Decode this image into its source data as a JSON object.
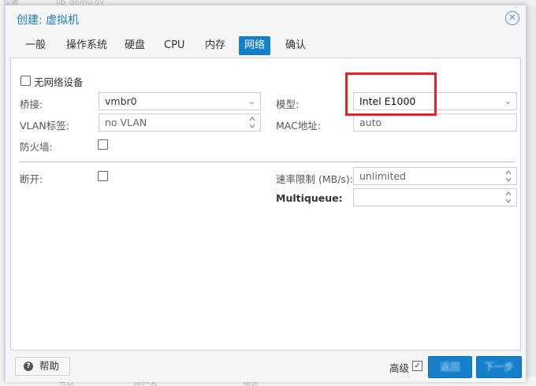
{
  "background": {
    "top_text": "仪暖",
    "top_text2": "lib_qemu.gv",
    "bottom_texts": [
      "节点",
      "用户名",
      "描述"
    ]
  },
  "dialog": {
    "title": "创建: 虚拟机",
    "close_icon": "close-circle-icon"
  },
  "tabs": [
    {
      "label": "一般"
    },
    {
      "label": "操作系统"
    },
    {
      "label": "硬盘"
    },
    {
      "label": "CPU"
    },
    {
      "label": "内存"
    },
    {
      "label": "网络",
      "active": true
    },
    {
      "label": "确认"
    }
  ],
  "form": {
    "no_network_label": "无网络设备",
    "bridge_label": "桥接:",
    "bridge_value": "vmbr0",
    "vlan_label": "VLAN标签:",
    "vlan_value": "no VLAN",
    "firewall_label": "防火墙:",
    "model_label": "模型:",
    "model_value": "Intel E1000",
    "mac_label": "MAC地址:",
    "mac_value": "auto",
    "disconnect_label": "断开:",
    "rate_label": "速率限制 (MB/s):",
    "rate_value": "unlimited",
    "multiqueue_label": "Multiqueue:",
    "multiqueue_value": ""
  },
  "footer": {
    "help_label": "帮助",
    "advanced_label": "高级",
    "back_label": "返回",
    "next_label": "下一步"
  },
  "colors": {
    "accent": "#157fcc",
    "highlight": "#e8222a"
  }
}
